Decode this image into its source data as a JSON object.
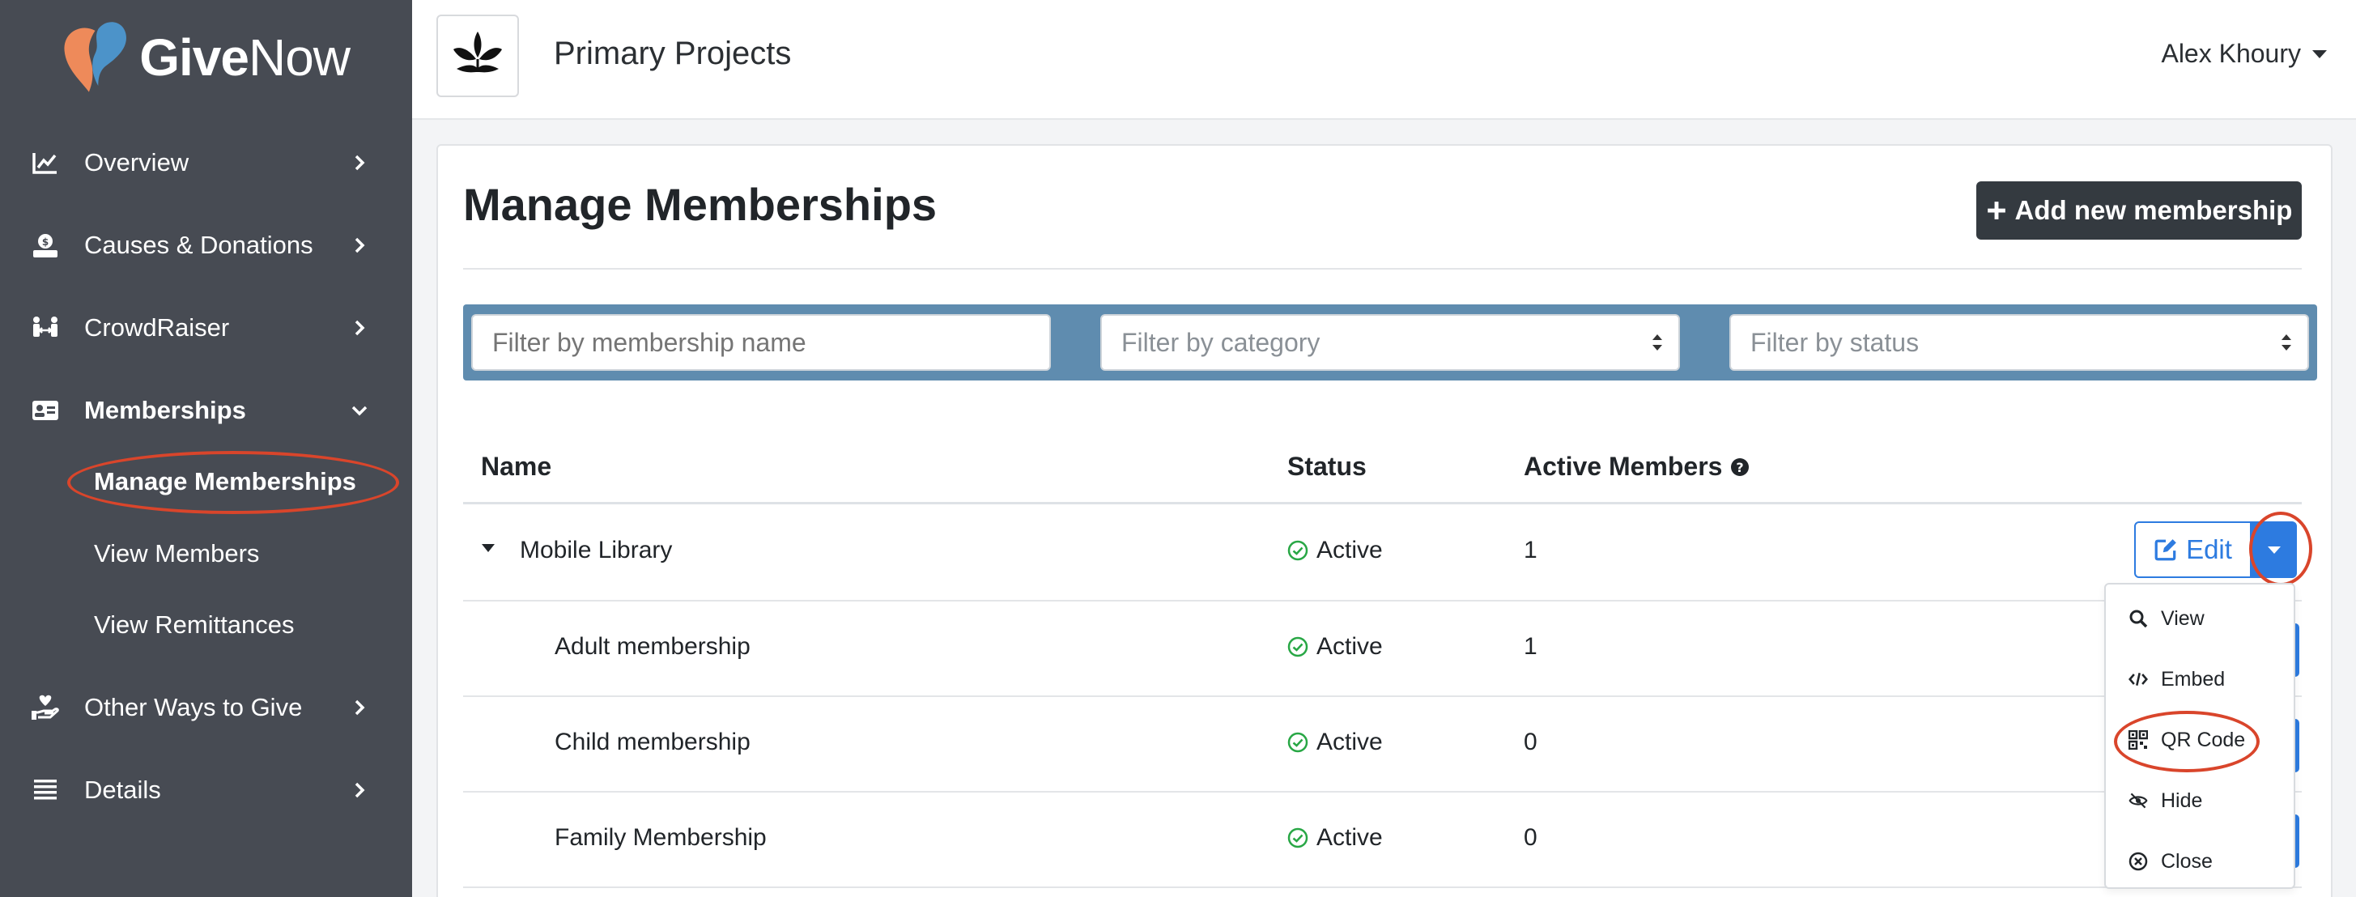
{
  "brand": {
    "logo_bold": "Give",
    "logo_light": "Now"
  },
  "sidebar": {
    "items": [
      {
        "label": "Overview",
        "icon": "chart-line-icon"
      },
      {
        "label": "Causes & Donations",
        "icon": "donate-icon"
      },
      {
        "label": "CrowdRaiser",
        "icon": "people-arrows-icon"
      },
      {
        "label": "Memberships",
        "icon": "id-card-icon"
      },
      {
        "label": "Other Ways to Give",
        "icon": "hand-heart-icon"
      },
      {
        "label": "Details",
        "icon": "list-icon"
      }
    ],
    "subitems": [
      {
        "label": "Manage Memberships"
      },
      {
        "label": "View Members"
      },
      {
        "label": "View Remittances"
      }
    ]
  },
  "header": {
    "org_name": "Primary Projects",
    "user_name": "Alex Khoury"
  },
  "main": {
    "title": "Manage Memberships",
    "add_button": "Add new membership",
    "filters": {
      "name_placeholder": "Filter by membership name",
      "category": "Filter by category",
      "status": "Filter by status"
    },
    "columns": {
      "name": "Name",
      "status": "Status",
      "active_members": "Active Members"
    },
    "rows": [
      {
        "name": "Mobile Library",
        "status": "Active",
        "active_members": "1"
      },
      {
        "name": "Adult membership",
        "status": "Active",
        "active_members": "1"
      },
      {
        "name": "Child membership",
        "status": "Active",
        "active_members": "0"
      },
      {
        "name": "Family Membership",
        "status": "Active",
        "active_members": "0"
      }
    ],
    "edit_label": "Edit",
    "dropdown": [
      {
        "label": "View",
        "icon": "search-icon"
      },
      {
        "label": "Embed",
        "icon": "code-icon"
      },
      {
        "label": "QR Code",
        "icon": "qrcode-icon"
      },
      {
        "label": "Hide",
        "icon": "eye-slash-icon"
      },
      {
        "label": "Close",
        "icon": "close-circle-icon"
      }
    ]
  },
  "colors": {
    "sidebar_bg": "#474b53",
    "accent_blue": "#2d7be0",
    "filter_bar": "#5f8caf",
    "active_green": "#28a745",
    "annotation_red": "#d9452b",
    "logo_orange": "#ee8a5a",
    "logo_blue": "#4c93c9"
  }
}
